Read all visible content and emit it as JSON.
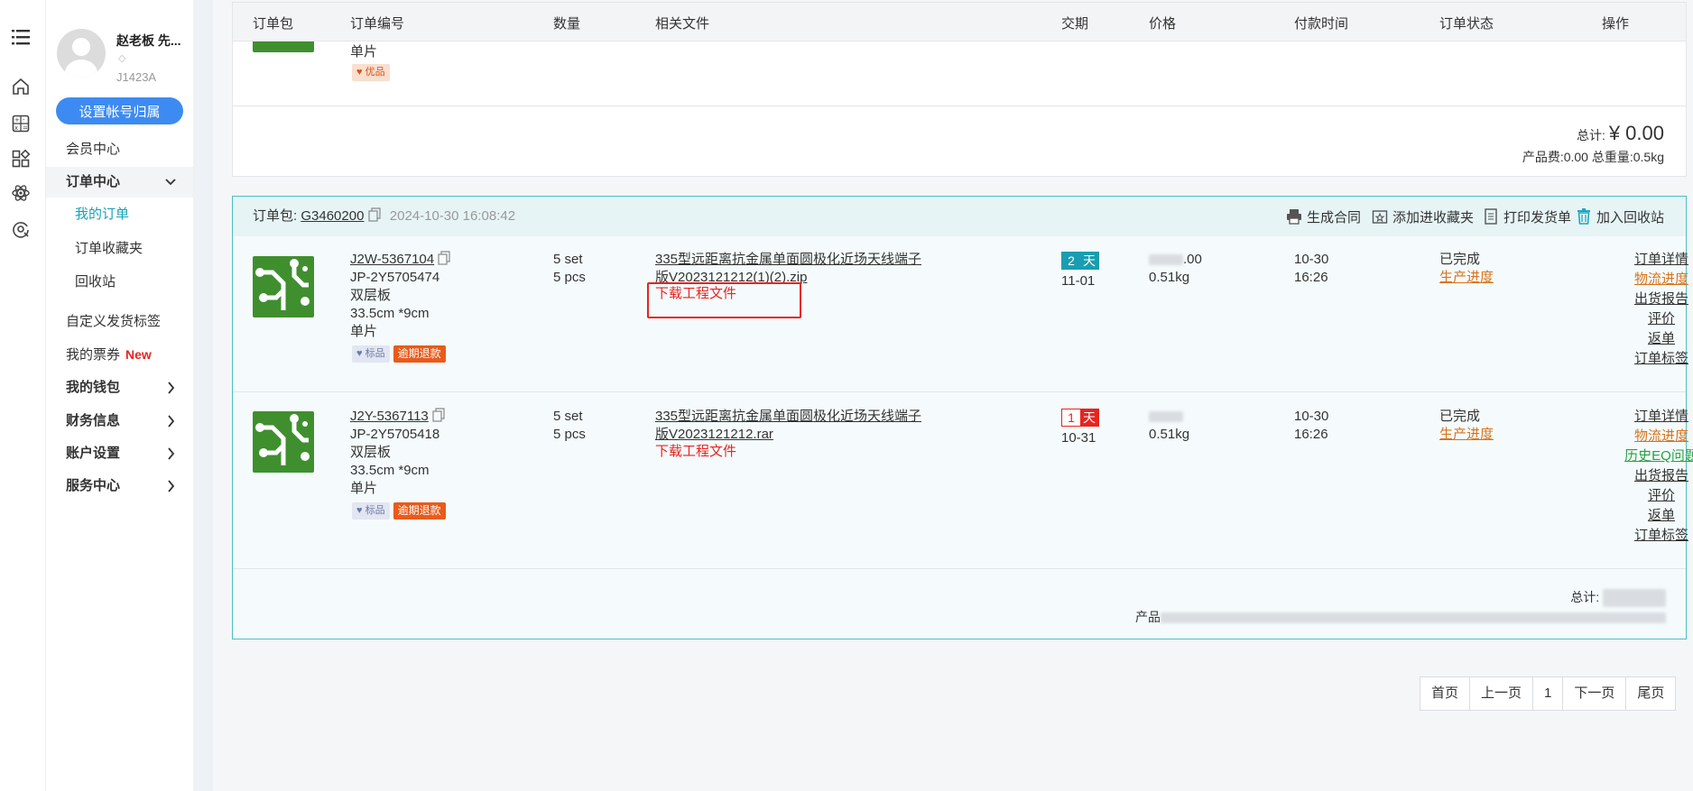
{
  "rail": {
    "icons": [
      "menu-icon",
      "home-icon",
      "calculator-icon",
      "apps-icon",
      "atom-icon",
      "scan-icon"
    ]
  },
  "sidebar": {
    "user_name": "赵老板 先...",
    "user_id": "J1423A",
    "set_button": "设置帐号归属",
    "items": [
      {
        "label": "会员中心"
      },
      {
        "label": "订单中心"
      },
      {
        "label": "我的订单"
      },
      {
        "label": "订单收藏夹"
      },
      {
        "label": "回收站"
      },
      {
        "label": "自定义发货标签"
      },
      {
        "label": "我的票券",
        "badge": "New"
      },
      {
        "label": "我的钱包"
      },
      {
        "label": "财务信息"
      },
      {
        "label": "账户设置"
      },
      {
        "label": "服务中心"
      }
    ]
  },
  "table": {
    "headers": [
      "订单包",
      "订单编号",
      "数量",
      "相关文件",
      "交期",
      "价格",
      "付款时间",
      "订单状态",
      "操作"
    ]
  },
  "prev": {
    "line1": "单片",
    "tag": "优品",
    "total_label": "总计:",
    "total_value": "¥ 0.00",
    "fee_line": "产品费:0.00 总重量:0.5kg"
  },
  "package": {
    "label": "订单包:",
    "id": "G3460200",
    "time": "2024-10-30 16:08:42",
    "actions": [
      "生成合同",
      "添加进收藏夹",
      "打印发货单",
      "加入回收站"
    ],
    "total_label": "总计:",
    "fee_prefix": "产品"
  },
  "orders": [
    {
      "id": "J2W-5367104",
      "part": "JP-2Y5705474",
      "layer": "双层板",
      "size": "33.5cm *9cm",
      "unit": "单片",
      "tags": [
        "标品",
        "逾期退款"
      ],
      "qty1": "5 set",
      "qty2": "5 pcs",
      "file1": "335型远距离抗金属单面圆极化近场天线端子",
      "file2": "版V2023121212(1)(2).zip",
      "download": "下载工程文件",
      "days": "2",
      "day_unit": "天",
      "due": "11-01",
      "price_suffix": ".00",
      "weight": "0.51kg",
      "pay_date": "10-30",
      "pay_time": "16:26",
      "status": "已完成",
      "progress": "生产进度",
      "ops": [
        "订单详情",
        "物流进度",
        "出货报告",
        "评价",
        "返单",
        "订单标签"
      ]
    },
    {
      "id": "J2Y-5367113",
      "part": "JP-2Y5705418",
      "layer": "双层板",
      "size": "33.5cm *9cm",
      "unit": "单片",
      "tags": [
        "标品",
        "逾期退款"
      ],
      "qty1": "5 set",
      "qty2": "5 pcs",
      "file1": "335型远距离抗金属单面圆极化近场天线端子",
      "file2": "版V2023121212.rar",
      "download": "下载工程文件",
      "days": "1",
      "day_unit": "天",
      "due": "10-31",
      "weight": "0.51kg",
      "pay_date": "10-30",
      "pay_time": "16:26",
      "status": "已完成",
      "progress": "生产进度",
      "ops": [
        "订单详情",
        "物流进度",
        "历史EQ问题",
        "出货报告",
        "评价",
        "返单",
        "订单标签"
      ]
    }
  ],
  "pager": [
    "首页",
    "上一页",
    "1",
    "下一页",
    "尾页"
  ],
  "colors": {
    "accent": "#3d8bf2",
    "teal": "#17a2b8",
    "border": "#4fbfc0",
    "red": "#e8231f",
    "orange": "#d9731b",
    "green": "#27a141",
    "pcb": "#3f8f2f"
  }
}
